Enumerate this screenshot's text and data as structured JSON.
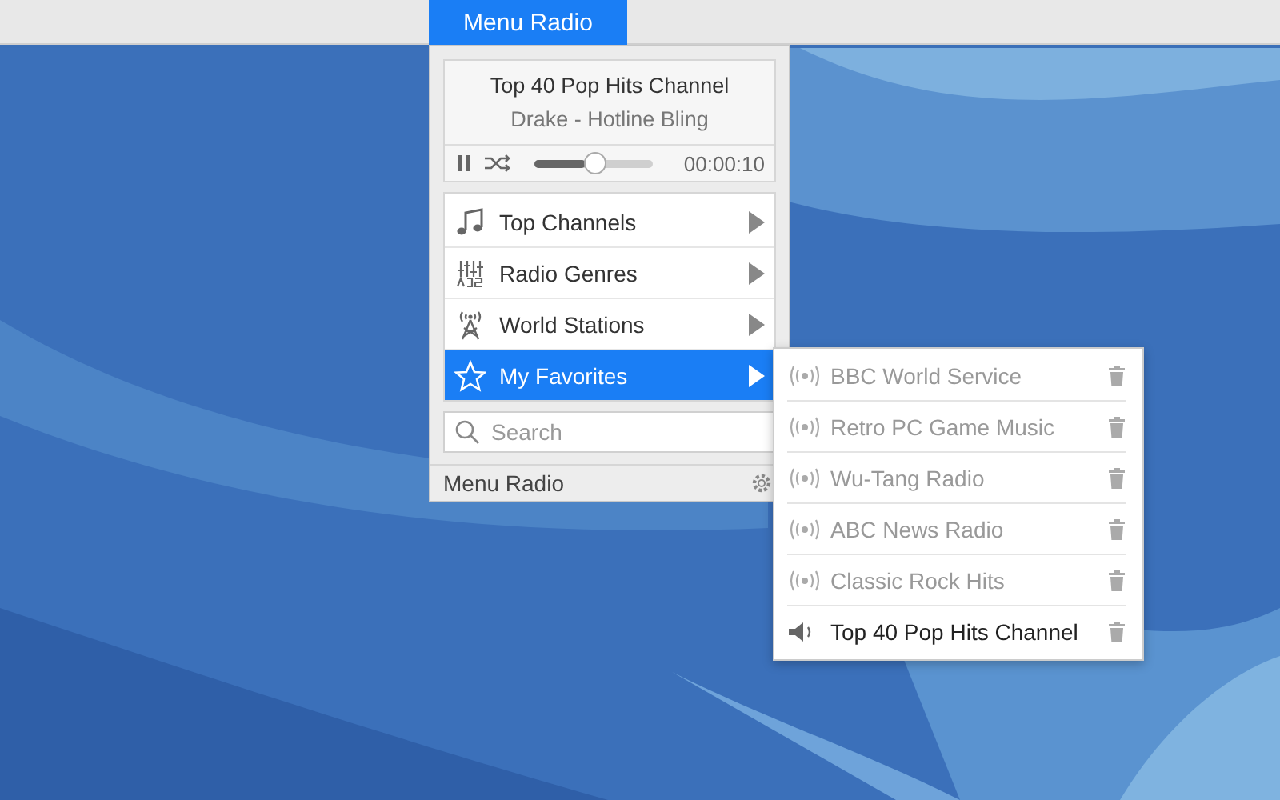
{
  "menu_bar": {
    "title": "Menu Radio",
    "selected": true
  },
  "player": {
    "station": "Top 40 Pop Hits Channel",
    "track": "Drake - Hotline Bling",
    "paused": false,
    "level": 0.43,
    "time": "00:00:10"
  },
  "menu_items": [
    {
      "label": "Top Channels",
      "kind": "music",
      "selected": false
    },
    {
      "label": "Radio Genres",
      "kind": "genres",
      "selected": false
    },
    {
      "label": "World Stations",
      "kind": "tower",
      "selected": false
    },
    {
      "label": "My Favorites",
      "kind": "star",
      "selected": true
    }
  ],
  "search": {
    "placeholder": "Search"
  },
  "footer": {
    "title": "Menu Radio"
  },
  "favorites": [
    {
      "name": "BBC World Service",
      "playing": false
    },
    {
      "name": "Retro PC Game Music",
      "playing": false
    },
    {
      "name": "Wu-Tang Radio",
      "playing": false
    },
    {
      "name": "ABC News Radio",
      "playing": false
    },
    {
      "name": "Classic Rock Hits",
      "playing": false
    },
    {
      "name": "Top 40 Pop Hits Channel",
      "playing": true
    }
  ]
}
